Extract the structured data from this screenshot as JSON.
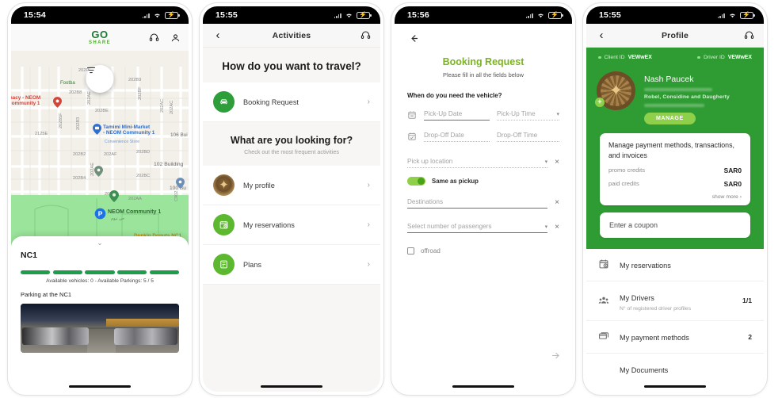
{
  "app": {
    "brand_go": "GO",
    "brand_share": "SHARE",
    "accent_green": "#2f9c33",
    "light_green": "#5cb82e",
    "title_green": "#7ab51d"
  },
  "screens": [
    {
      "id": "map",
      "status": {
        "time": "15:54"
      },
      "header": {
        "logo_go": "GO",
        "logo_share": "SHARE",
        "support_icon": "headset-icon",
        "account_icon": "account-icon",
        "filter_icon": "filter-icon"
      },
      "map": {
        "labels": [
          "202P",
          "202B9",
          "202B8",
          "202BE",
          "202AE",
          "202BF",
          "202AC",
          "202AC",
          "2125E",
          "202B5F",
          "202B3",
          "202B2",
          "202AF",
          "202BD",
          "102 Building",
          "106 Bui",
          "100 Bu",
          "202B4",
          "202BC",
          "202AE",
          "202B5",
          "202AA",
          "202A",
          "C902",
          "201"
        ],
        "pois": [
          {
            "name": "Footba",
            "type": "green-text"
          },
          {
            "name": "macy - NEOM Community 1",
            "type": "red-pin"
          },
          {
            "name": "Tamimi Mini-Market - NEOM Community 1",
            "sub": "Convenience Store",
            "type": "blue-pin"
          },
          {
            "name": "NEOM Community 1",
            "type": "green-pin"
          },
          {
            "name": "Dunkin Donuts NC1",
            "type": "yellow-pin"
          }
        ],
        "parking_marker": "P"
      },
      "sheet": {
        "title": "NC1",
        "bars_count": 5,
        "availability": "Available vehicles: 0 - Available Parkings: 5 / 5",
        "caption": "Parking at the NC1",
        "photo_alt": "parking-lot-photo"
      }
    },
    {
      "id": "activities",
      "status": {
        "time": "15:55"
      },
      "navbar": {
        "back_icon": "chevron-left-icon",
        "title": "Activities",
        "support_icon": "headset-icon"
      },
      "section1": {
        "heading": "How do you want to travel?"
      },
      "section1_items": [
        {
          "label": "Booking Request",
          "icon": "car-icon",
          "tone": "dark"
        }
      ],
      "section2": {
        "heading": "What are you looking for?",
        "sub": "Check out the most frequent activities"
      },
      "section2_items": [
        {
          "label": "My profile",
          "icon": "medal-star-icon",
          "tone": "medal"
        },
        {
          "label": "My reservations",
          "icon": "calendar-clock-icon",
          "tone": "light"
        },
        {
          "label": "Plans",
          "icon": "document-icon",
          "tone": "light"
        }
      ],
      "chevron": "›"
    },
    {
      "id": "booking",
      "status": {
        "time": "15:56"
      },
      "back_icon": "arrow-left-icon",
      "title": "Booking Request",
      "subtitle": "Please fill in all the fields below",
      "question": "When do you need the vehicle?",
      "fields": [
        {
          "name": "pickup-date",
          "placeholder": "Pick-Up Date",
          "icon": "calendar-icon",
          "underline": "solid"
        },
        {
          "name": "pickup-time",
          "placeholder": "Pick-Up Time",
          "caret": "▾",
          "underline": "dotted"
        },
        {
          "name": "dropoff-date",
          "placeholder": "Drop-Off Date",
          "icon": "calendar-check-icon",
          "underline": "dotted"
        },
        {
          "name": "dropoff-time",
          "placeholder": "Drop-Off Time",
          "underline": "dotted"
        },
        {
          "name": "pickup-location",
          "placeholder": "Pick up location",
          "caret": "▾",
          "clear": "×",
          "underline": "dotted"
        },
        {
          "name": "destinations",
          "placeholder": "Destinations",
          "clear": "×",
          "underline": "solid"
        },
        {
          "name": "passengers",
          "placeholder": "Select number of passengers",
          "caret": "▾",
          "clear": "×",
          "underline": "solid"
        }
      ],
      "toggle": {
        "label": "Same as pickup",
        "on": true
      },
      "checkbox": {
        "label": "offroad",
        "checked": false
      },
      "next_icon": "arrow-right-icon"
    },
    {
      "id": "profile",
      "status": {
        "time": "15:55"
      },
      "navbar": {
        "back_icon": "chevron-left-icon",
        "title": "Profile",
        "support_icon": "headset-icon"
      },
      "ids": [
        {
          "label": "Client ID",
          "value": "VEWwEX"
        },
        {
          "label": "Driver ID",
          "value": "VEWwEX"
        }
      ],
      "user": {
        "name": "Nash Paucek",
        "company": "Robel, Considine and Daugherty",
        "manage_label": "MANAGE",
        "avatar_icon": "medal-star-avatar",
        "add_icon": "plus-icon"
      },
      "payment_card": {
        "title": "Manage payment methods, transactions, and invoices",
        "rows": [
          {
            "key": "promo credits",
            "value": "SAR0"
          },
          {
            "key": "paid credits",
            "value": "SAR0"
          }
        ],
        "show_more": "show more ›"
      },
      "coupon": {
        "placeholder": "Enter a coupon"
      },
      "list": [
        {
          "label": "My reservations",
          "sub": "",
          "count": "",
          "icon": "calendar-clock-icon"
        },
        {
          "label": "My Drivers",
          "sub": "N° of registered driver profiles",
          "count": "1/1",
          "icon": "people-icon"
        },
        {
          "label": "My payment methods",
          "sub": "",
          "count": "2",
          "icon": "card-icon"
        },
        {
          "label": "My Documents",
          "sub": "",
          "count": "",
          "icon": ""
        }
      ]
    }
  ]
}
